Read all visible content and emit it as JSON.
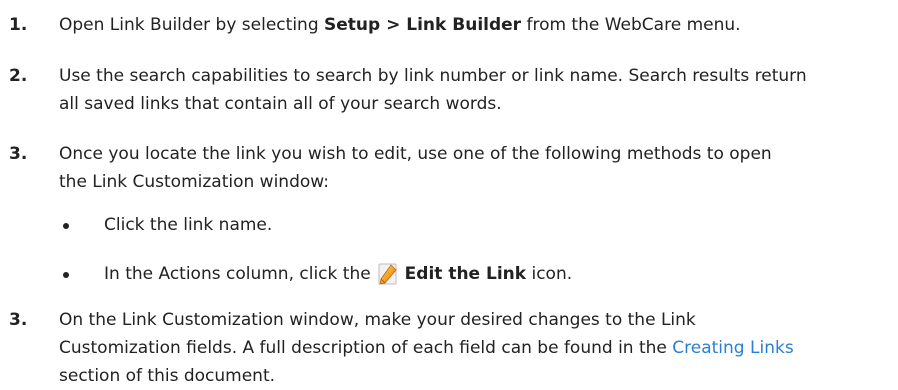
{
  "steps": [
    {
      "number": "1.",
      "text_before": "Open Link Builder by selecting ",
      "bold": "Setup > Link Builder",
      "text_after": " from the WebCare menu."
    },
    {
      "number": "2.",
      "line1": "Use the search capabilities to search by link number or link name. Search results return",
      "line2": "all saved links that contain all of your search words."
    },
    {
      "number": "3.",
      "line1": "Once you locate the link you wish to edit, use one of the following methods to open",
      "line2": "the Link Customization window:",
      "bullets": [
        {
          "text": "Click the link name."
        },
        {
          "text_before": "In the Actions column, click the",
          "bold": "Edit the Link",
          "text_after": " icon.",
          "icon": "edit-pencil-icon"
        }
      ]
    },
    {
      "number": "3.",
      "line1": "On the Link Customization window, make your desired changes to the Link",
      "line2_before": "Customization fields. A full description of each field can be found in the ",
      "link_text": "Creating Links",
      "line3": "section of this document."
    }
  ],
  "colors": {
    "text": "#222222",
    "link": "#2a7fd1",
    "icon_orange": "#f0a020"
  }
}
